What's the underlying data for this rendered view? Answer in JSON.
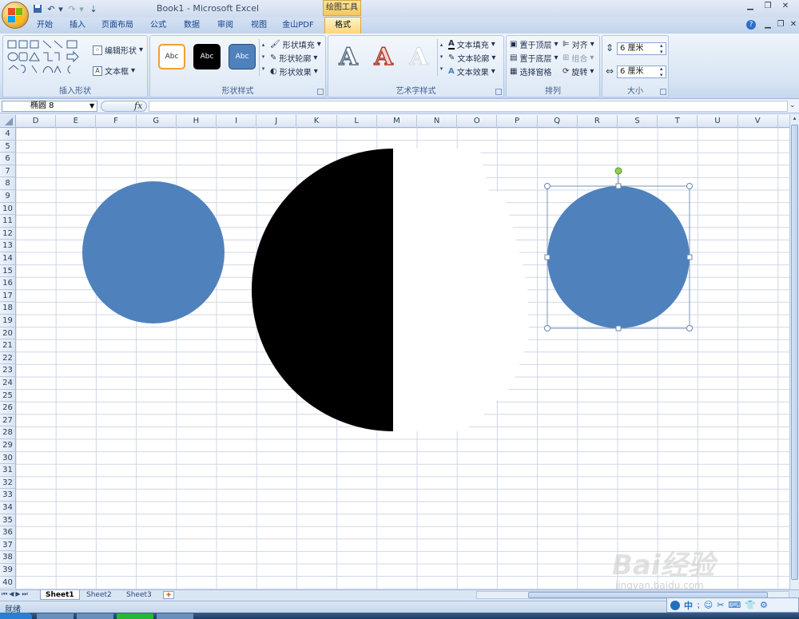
{
  "app": {
    "title": "Book1 - Microsoft Excel",
    "tool_context": "绘图工具"
  },
  "tabs": [
    {
      "label": "开始"
    },
    {
      "label": "插入"
    },
    {
      "label": "页面布局"
    },
    {
      "label": "公式"
    },
    {
      "label": "数据"
    },
    {
      "label": "审阅"
    },
    {
      "label": "视图"
    },
    {
      "label": "金山PDF"
    },
    {
      "label": "格式"
    }
  ],
  "ribbon": {
    "insert_shapes": {
      "label": "插入形状",
      "edit_shape": "编辑形状",
      "text_box": "文本框"
    },
    "shape_styles": {
      "label": "形状样式",
      "thumb_text": "Abc",
      "fill": "形状填充",
      "outline": "形状轮廓",
      "effects": "形状效果"
    },
    "wordart_styles": {
      "label": "艺术字样式",
      "letter": "A",
      "text_fill": "文本填充",
      "text_outline": "文本轮廓",
      "text_effects": "文本效果"
    },
    "arrange": {
      "label": "排列",
      "bring_front": "置于顶层",
      "send_back": "置于底层",
      "selection_pane": "选择窗格",
      "align": "对齐",
      "group": "组合",
      "rotate": "旋转"
    },
    "size": {
      "label": "大小",
      "height": "6 厘米",
      "width": "6 厘米"
    }
  },
  "formula_bar": {
    "name_box": "椭圆 8",
    "fx": "fx",
    "value": ""
  },
  "columns": [
    "D",
    "E",
    "F",
    "G",
    "H",
    "I",
    "J",
    "K",
    "L",
    "M",
    "N",
    "O",
    "P",
    "Q",
    "R",
    "S",
    "T",
    "U",
    "V"
  ],
  "rows": [
    "4",
    "5",
    "6",
    "7",
    "8",
    "9",
    "10",
    "11",
    "12",
    "13",
    "14",
    "15",
    "16",
    "17",
    "18",
    "19",
    "20",
    "21",
    "22",
    "23",
    "24",
    "25",
    "26",
    "27",
    "28",
    "29",
    "30",
    "31",
    "32",
    "33",
    "34",
    "35",
    "36",
    "37",
    "38",
    "39",
    "40"
  ],
  "sheets": [
    {
      "label": "Sheet1",
      "active": true
    },
    {
      "label": "Sheet2",
      "active": false
    },
    {
      "label": "Sheet3",
      "active": false
    }
  ],
  "status": {
    "ready": "就绪"
  },
  "ime": {
    "lang": "中"
  },
  "watermark": {
    "brand": "Bai经验",
    "url": "jingyan.baidu.com"
  },
  "colors": {
    "shape_blue": "#4f81bd",
    "half_circle": "#000000",
    "selection": "#7a95b8",
    "rotate_handle": "#8fd14f"
  }
}
